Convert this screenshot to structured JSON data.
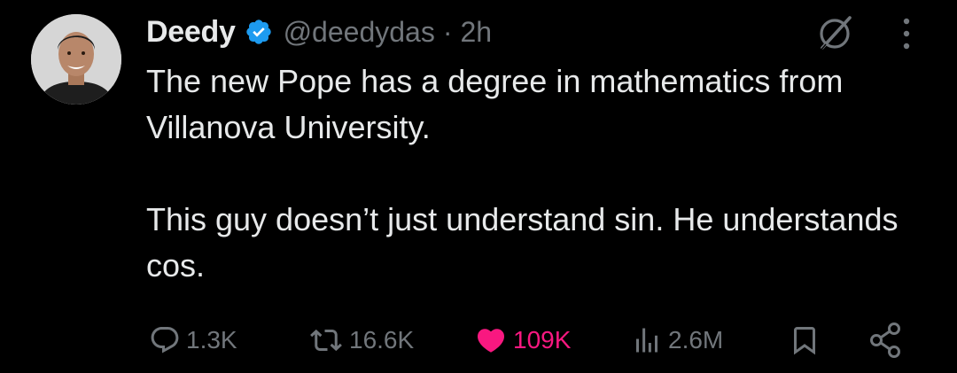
{
  "author": {
    "display_name": "Deedy",
    "handle": "@deedydas",
    "separator": "·",
    "time": "2h",
    "verified_color": "#1d9bf0"
  },
  "tweet": {
    "paragraphs": [
      "The new Pope has a degree in mathematics from Villanova University.",
      "This guy doesn’t just understand sin. He understands cos."
    ]
  },
  "actions": {
    "replies": "1.3K",
    "reposts": "16.6K",
    "likes": "109K",
    "views": "2.6M",
    "like_color": "#f91880"
  },
  "icons": {
    "avatar": "profile-photo",
    "verified": "verified-badge-icon",
    "grok": "grok-icon",
    "more": "more-icon",
    "reply": "reply-icon",
    "repost": "repost-icon",
    "like": "heart-icon",
    "views": "views-icon",
    "bookmark": "bookmark-icon",
    "share": "share-icon"
  }
}
